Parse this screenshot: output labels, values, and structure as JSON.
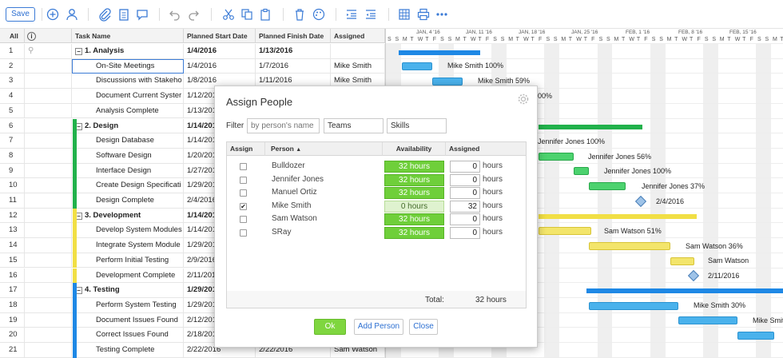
{
  "toolbar": {
    "save_label": "Save"
  },
  "grid": {
    "headers": {
      "all": "All",
      "task_name": "Task Name",
      "planned_start": "Planned Start Date",
      "planned_finish": "Planned Finish Date",
      "assigned": "Assigned"
    },
    "rows": [
      {
        "num": "1",
        "name": "1. Analysis",
        "start": "1/4/2016",
        "finish": "1/13/2016",
        "assigned": ""
      },
      {
        "num": "2",
        "name": "On-Site Meetings",
        "start": "1/4/2016",
        "finish": "1/7/2016",
        "assigned": "Mike Smith"
      },
      {
        "num": "3",
        "name": "Discussions with Stakeho",
        "start": "1/8/2016",
        "finish": "1/11/2016",
        "assigned": "Mike Smith"
      },
      {
        "num": "4",
        "name": "Document Current Syster",
        "start": "1/12/2016",
        "finish": "",
        "assigned": ""
      },
      {
        "num": "5",
        "name": "Analysis Complete",
        "start": "1/13/2016",
        "finish": "",
        "assigned": ""
      },
      {
        "num": "6",
        "name": "2. Design",
        "start": "1/14/2016",
        "finish": "",
        "assigned": ""
      },
      {
        "num": "7",
        "name": "Design Database",
        "start": "1/14/2016",
        "finish": "",
        "assigned": ""
      },
      {
        "num": "8",
        "name": "Software Design",
        "start": "1/20/2016",
        "finish": "",
        "assigned": ""
      },
      {
        "num": "9",
        "name": "Interface Design",
        "start": "1/27/2016",
        "finish": "",
        "assigned": ""
      },
      {
        "num": "10",
        "name": "Create Design Specificati",
        "start": "1/29/2016",
        "finish": "",
        "assigned": ""
      },
      {
        "num": "11",
        "name": "Design Complete",
        "start": "2/4/2016",
        "finish": "",
        "assigned": ""
      },
      {
        "num": "12",
        "name": "3. Development",
        "start": "1/14/2016",
        "finish": "",
        "assigned": ""
      },
      {
        "num": "13",
        "name": "Develop System Modules",
        "start": "1/14/2016",
        "finish": "",
        "assigned": ""
      },
      {
        "num": "14",
        "name": "Integrate System Module",
        "start": "1/29/2016",
        "finish": "",
        "assigned": ""
      },
      {
        "num": "15",
        "name": "Perform Initial Testing",
        "start": "2/9/2016",
        "finish": "",
        "assigned": ""
      },
      {
        "num": "16",
        "name": "Development Complete",
        "start": "2/11/2016",
        "finish": "",
        "assigned": ""
      },
      {
        "num": "17",
        "name": "4. Testing",
        "start": "1/29/2016",
        "finish": "",
        "assigned": ""
      },
      {
        "num": "18",
        "name": "Perform System Testing",
        "start": "1/29/2016",
        "finish": "",
        "assigned": ""
      },
      {
        "num": "19",
        "name": "Document Issues Found",
        "start": "2/12/2016",
        "finish": "",
        "assigned": ""
      },
      {
        "num": "20",
        "name": "Correct Issues Found",
        "start": "2/18/2016",
        "finish": "",
        "assigned": ""
      },
      {
        "num": "21",
        "name": "Testing Complete",
        "start": "2/22/2016",
        "finish": "2/22/2016",
        "assigned": "Sam Watson"
      }
    ]
  },
  "gantt": {
    "weeks": [
      "JAN, 4 '16",
      "JAN, 11 '16",
      "JAN, 18 '16",
      "JAN, 25 '16",
      "FEB, 1 '16",
      "FEB, 8 '16",
      "FEB, 15 '16"
    ],
    "days": [
      "S",
      "S",
      "M",
      "T",
      "W",
      "T",
      "F",
      "S",
      "S",
      "M",
      "T",
      "W",
      "T",
      "F",
      "S",
      "S",
      "M",
      "T",
      "W",
      "T",
      "F",
      "S",
      "S",
      "M",
      "T",
      "W",
      "T",
      "F",
      "S",
      "S",
      "M",
      "T",
      "W",
      "T",
      "F",
      "S",
      "S",
      "M",
      "T",
      "W",
      "T",
      "F",
      "S",
      "S",
      "M",
      "T",
      "W",
      "T",
      "F",
      "S",
      "S",
      "M",
      "T",
      "W",
      "T",
      "F",
      "S",
      "S",
      "M",
      "T"
    ],
    "labels": {
      "r2": "Mike Smith  100%",
      "r3": "Mike Smith  59%",
      "r4": "00%",
      "r7": "Jennifer Jones  100%",
      "r8": "Jennifer Jones  56%",
      "r9": "Jennifer Jones  100%",
      "r10": "Jennifer Jones  37%",
      "r11": "2/4/2016",
      "r13": "Sam Watson  51%",
      "r14": "Sam Watson  36%",
      "r15": "Sam Watson",
      "r16": "2/11/2016",
      "r18": "Mike Smith  30%",
      "r19": "Mike Smith"
    },
    "colors": {
      "analysis": "#1e88e5",
      "design": "#21b14b",
      "development": "#f1df45",
      "testing": "#1e88e5"
    }
  },
  "modal": {
    "title": "Assign People",
    "filter_label": "Filter",
    "filter_placeholder": "by person's name",
    "teams_value": "Teams",
    "skills_value": "Skills",
    "columns": {
      "assign": "Assign",
      "person": "Person",
      "sort": "▲",
      "availability": "Availability",
      "assigned": "Assigned"
    },
    "people": [
      {
        "name": "Bulldozer",
        "checked": false,
        "availability": "32 hours",
        "assigned": "0",
        "unit": "hours"
      },
      {
        "name": "Jennifer Jones",
        "checked": false,
        "availability": "32 hours",
        "assigned": "0",
        "unit": "hours"
      },
      {
        "name": "Manuel Ortiz",
        "checked": false,
        "availability": "32 hours",
        "assigned": "0",
        "unit": "hours"
      },
      {
        "name": "Mike Smith",
        "checked": true,
        "availability": "0 hours",
        "assigned": "32",
        "unit": "hours"
      },
      {
        "name": "Sam Watson",
        "checked": false,
        "availability": "32 hours",
        "assigned": "0",
        "unit": "hours"
      },
      {
        "name": "SRay",
        "checked": false,
        "availability": "32 hours",
        "assigned": "0",
        "unit": "hours"
      }
    ],
    "total_label": "Total:",
    "total_value": "32 hours",
    "buttons": {
      "ok": "Ok",
      "add_person": "Add Person",
      "close": "Close"
    }
  }
}
